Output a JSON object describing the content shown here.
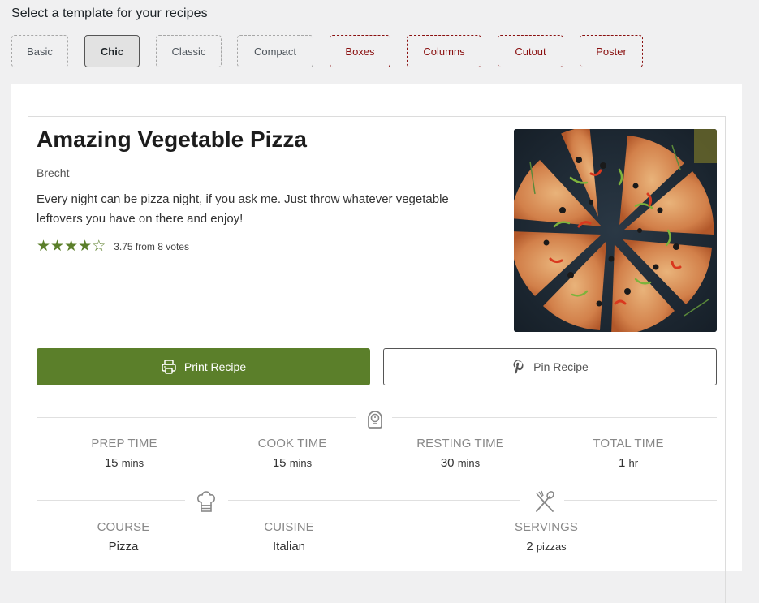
{
  "page": {
    "heading": "Select a template for your recipes"
  },
  "templates": [
    {
      "label": "Basic",
      "state": "normal"
    },
    {
      "label": "Chic",
      "state": "active"
    },
    {
      "label": "Classic",
      "state": "normal"
    },
    {
      "label": "Compact",
      "state": "normal"
    },
    {
      "label": "Boxes",
      "state": "premium"
    },
    {
      "label": "Columns",
      "state": "premium"
    },
    {
      "label": "Cutout",
      "state": "premium"
    },
    {
      "label": "Poster",
      "state": "premium"
    }
  ],
  "recipe": {
    "title": "Amazing Vegetable Pizza",
    "author": "Brecht",
    "summary": "Every night can be pizza night, if you ask me. Just throw whatever vegetable leftovers you have on there and enjoy!",
    "rating": {
      "value": 3.75,
      "max": 5,
      "text": "3.75 from 8 votes",
      "stars": [
        "full",
        "full",
        "full",
        "full",
        "empty"
      ]
    },
    "image_alt": "Sliced vegetable pizza on dark surface",
    "buttons": {
      "print_label": "Print Recipe",
      "print_icon": "printer-icon",
      "pin_label": "Pin Recipe",
      "pin_icon": "pinterest-icon"
    },
    "times": {
      "icon": "timer-icon",
      "items": [
        {
          "label": "PREP TIME",
          "value": "15",
          "unit": "mins"
        },
        {
          "label": "COOK TIME",
          "value": "15",
          "unit": "mins"
        },
        {
          "label": "RESTING TIME",
          "value": "30",
          "unit": "mins"
        },
        {
          "label": "TOTAL TIME",
          "value": "1",
          "unit": "hr"
        }
      ]
    },
    "tags": {
      "course_icon": "chef-hat-icon",
      "servings_icon": "utensils-icon",
      "course": {
        "label": "COURSE",
        "value": "Pizza"
      },
      "cuisine": {
        "label": "CUISINE",
        "value": "Italian"
      },
      "servings": {
        "label": "SERVINGS",
        "value": "2",
        "unit": "pizzas"
      }
    }
  },
  "colors": {
    "accent_green": "#5b7f2a",
    "premium_red": "#8a1010",
    "background": "#f0f0f1"
  }
}
